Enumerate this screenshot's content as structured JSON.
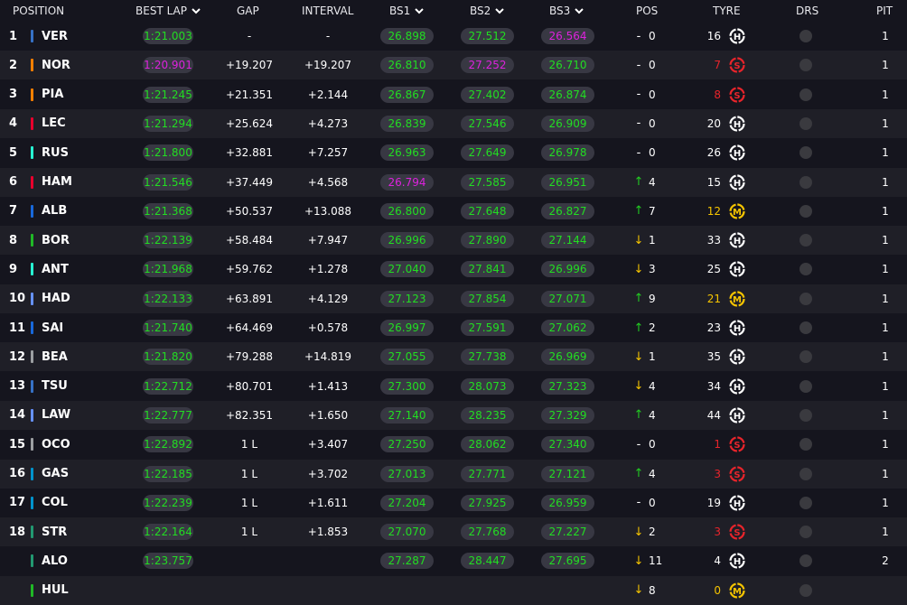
{
  "headers": {
    "position": "POSITION",
    "best_lap": "BEST LAP",
    "gap": "GAP",
    "interval": "INTERVAL",
    "bs1": "BS1",
    "bs2": "BS2",
    "bs3": "BS3",
    "pos": "POS",
    "tyre": "TYRE",
    "drs": "DRS",
    "pit": "PIT"
  },
  "colors": {
    "background": "#15151e",
    "row_alt": "#1f1f27",
    "pill_bg": "#383843",
    "best_green": "#22dd22",
    "best_purple": "#dd22dd",
    "pos_up": "#22cc22",
    "pos_down": "#f5c400",
    "tyre_soft": "#e8242b",
    "tyre_medium": "#f5c400",
    "tyre_hard": "#ffffff"
  },
  "rows": [
    {
      "position": "1",
      "code": "VER",
      "team_color": "#3671c6",
      "best_lap": "1:21.003",
      "best_lap_color": "green",
      "gap": "-",
      "interval": "-",
      "bs1": "26.898",
      "bs1_color": "green",
      "bs2": "27.512",
      "bs2_color": "green",
      "bs3": "26.564",
      "bs3_color": "purple",
      "pos_arrow": "-",
      "pos_direction": "none",
      "pos_change": "0",
      "laps": "16",
      "tyre": "H",
      "tyre_icon": "hard-tyre-icon",
      "tyre_color": "#ffffff",
      "pit": "1"
    },
    {
      "position": "2",
      "code": "NOR",
      "team_color": "#ff8000",
      "best_lap": "1:20.901",
      "best_lap_color": "purple",
      "gap": "+19.207",
      "interval": "+19.207",
      "bs1": "26.810",
      "bs1_color": "green",
      "bs2": "27.252",
      "bs2_color": "purple",
      "bs3": "26.710",
      "bs3_color": "green",
      "pos_arrow": "-",
      "pos_direction": "none",
      "pos_change": "0",
      "laps": "7",
      "tyre": "S",
      "tyre_icon": "soft-tyre-icon",
      "tyre_color": "#e8242b",
      "pit": "1"
    },
    {
      "position": "3",
      "code": "PIA",
      "team_color": "#ff8000",
      "best_lap": "1:21.245",
      "best_lap_color": "green",
      "gap": "+21.351",
      "interval": "+2.144",
      "bs1": "26.867",
      "bs1_color": "green",
      "bs2": "27.402",
      "bs2_color": "green",
      "bs3": "26.874",
      "bs3_color": "green",
      "pos_arrow": "-",
      "pos_direction": "none",
      "pos_change": "0",
      "laps": "8",
      "tyre": "S",
      "tyre_icon": "soft-tyre-icon",
      "tyre_color": "#e8242b",
      "pit": "1"
    },
    {
      "position": "4",
      "code": "LEC",
      "team_color": "#e8002d",
      "best_lap": "1:21.294",
      "best_lap_color": "green",
      "gap": "+25.624",
      "interval": "+4.273",
      "bs1": "26.839",
      "bs1_color": "green",
      "bs2": "27.546",
      "bs2_color": "green",
      "bs3": "26.909",
      "bs3_color": "green",
      "pos_arrow": "-",
      "pos_direction": "none",
      "pos_change": "0",
      "laps": "20",
      "tyre": "H",
      "tyre_icon": "hard-tyre-icon",
      "tyre_color": "#ffffff",
      "pit": "1"
    },
    {
      "position": "5",
      "code": "RUS",
      "team_color": "#27f4d2",
      "best_lap": "1:21.800",
      "best_lap_color": "green",
      "gap": "+32.881",
      "interval": "+7.257",
      "bs1": "26.963",
      "bs1_color": "green",
      "bs2": "27.649",
      "bs2_color": "green",
      "bs3": "26.978",
      "bs3_color": "green",
      "pos_arrow": "-",
      "pos_direction": "none",
      "pos_change": "0",
      "laps": "26",
      "tyre": "H",
      "tyre_icon": "hard-tyre-icon",
      "tyre_color": "#ffffff",
      "pit": "1"
    },
    {
      "position": "6",
      "code": "HAM",
      "team_color": "#e8002d",
      "best_lap": "1:21.546",
      "best_lap_color": "green",
      "gap": "+37.449",
      "interval": "+4.568",
      "bs1": "26.794",
      "bs1_color": "purple",
      "bs2": "27.585",
      "bs2_color": "green",
      "bs3": "26.951",
      "bs3_color": "green",
      "pos_arrow": "↑",
      "pos_direction": "up",
      "pos_change": "4",
      "laps": "15",
      "tyre": "H",
      "tyre_icon": "hard-tyre-icon",
      "tyre_color": "#ffffff",
      "pit": "1"
    },
    {
      "position": "7",
      "code": "ALB",
      "team_color": "#1868db",
      "best_lap": "1:21.368",
      "best_lap_color": "green",
      "gap": "+50.537",
      "interval": "+13.088",
      "bs1": "26.800",
      "bs1_color": "green",
      "bs2": "27.648",
      "bs2_color": "green",
      "bs3": "26.827",
      "bs3_color": "green",
      "pos_arrow": "↑",
      "pos_direction": "up",
      "pos_change": "7",
      "laps": "12",
      "tyre": "M",
      "tyre_icon": "medium-tyre-icon",
      "tyre_color": "#f5c400",
      "pit": "1"
    },
    {
      "position": "8",
      "code": "BOR",
      "team_color": "#20b826",
      "best_lap": "1:22.139",
      "best_lap_color": "green",
      "gap": "+58.484",
      "interval": "+7.947",
      "bs1": "26.996",
      "bs1_color": "green",
      "bs2": "27.890",
      "bs2_color": "green",
      "bs3": "27.144",
      "bs3_color": "green",
      "pos_arrow": "↓",
      "pos_direction": "down",
      "pos_change": "1",
      "laps": "33",
      "tyre": "H",
      "tyre_icon": "hard-tyre-icon",
      "tyre_color": "#ffffff",
      "pit": "1"
    },
    {
      "position": "9",
      "code": "ANT",
      "team_color": "#27f4d2",
      "best_lap": "1:21.968",
      "best_lap_color": "green",
      "gap": "+59.762",
      "interval": "+1.278",
      "bs1": "27.040",
      "bs1_color": "green",
      "bs2": "27.841",
      "bs2_color": "green",
      "bs3": "26.996",
      "bs3_color": "green",
      "pos_arrow": "↓",
      "pos_direction": "down",
      "pos_change": "3",
      "laps": "25",
      "tyre": "H",
      "tyre_icon": "hard-tyre-icon",
      "tyre_color": "#ffffff",
      "pit": "1"
    },
    {
      "position": "10",
      "code": "HAD",
      "team_color": "#6692ff",
      "best_lap": "1:22.133",
      "best_lap_color": "green",
      "gap": "+63.891",
      "interval": "+4.129",
      "bs1": "27.123",
      "bs1_color": "green",
      "bs2": "27.854",
      "bs2_color": "green",
      "bs3": "27.071",
      "bs3_color": "green",
      "pos_arrow": "↑",
      "pos_direction": "up",
      "pos_change": "9",
      "laps": "21",
      "tyre": "M",
      "tyre_icon": "medium-tyre-icon",
      "tyre_color": "#f5c400",
      "pit": "1"
    },
    {
      "position": "11",
      "code": "SAI",
      "team_color": "#1868db",
      "best_lap": "1:21.740",
      "best_lap_color": "green",
      "gap": "+64.469",
      "interval": "+0.578",
      "bs1": "26.997",
      "bs1_color": "green",
      "bs2": "27.591",
      "bs2_color": "green",
      "bs3": "27.062",
      "bs3_color": "green",
      "pos_arrow": "↑",
      "pos_direction": "up",
      "pos_change": "2",
      "laps": "23",
      "tyre": "H",
      "tyre_icon": "hard-tyre-icon",
      "tyre_color": "#ffffff",
      "pit": "1"
    },
    {
      "position": "12",
      "code": "BEA",
      "team_color": "#9c9fa2",
      "best_lap": "1:21.820",
      "best_lap_color": "green",
      "gap": "+79.288",
      "interval": "+14.819",
      "bs1": "27.055",
      "bs1_color": "green",
      "bs2": "27.738",
      "bs2_color": "green",
      "bs3": "26.969",
      "bs3_color": "green",
      "pos_arrow": "↓",
      "pos_direction": "down",
      "pos_change": "1",
      "laps": "35",
      "tyre": "H",
      "tyre_icon": "hard-tyre-icon",
      "tyre_color": "#ffffff",
      "pit": "1"
    },
    {
      "position": "13",
      "code": "TSU",
      "team_color": "#3671c6",
      "best_lap": "1:22.712",
      "best_lap_color": "green",
      "gap": "+80.701",
      "interval": "+1.413",
      "bs1": "27.300",
      "bs1_color": "green",
      "bs2": "28.073",
      "bs2_color": "green",
      "bs3": "27.323",
      "bs3_color": "green",
      "pos_arrow": "↓",
      "pos_direction": "down",
      "pos_change": "4",
      "laps": "34",
      "tyre": "H",
      "tyre_icon": "hard-tyre-icon",
      "tyre_color": "#ffffff",
      "pit": "1"
    },
    {
      "position": "14",
      "code": "LAW",
      "team_color": "#6692ff",
      "best_lap": "1:22.777",
      "best_lap_color": "green",
      "gap": "+82.351",
      "interval": "+1.650",
      "bs1": "27.140",
      "bs1_color": "green",
      "bs2": "28.235",
      "bs2_color": "green",
      "bs3": "27.329",
      "bs3_color": "green",
      "pos_arrow": "↑",
      "pos_direction": "up",
      "pos_change": "4",
      "laps": "44",
      "tyre": "H",
      "tyre_icon": "hard-tyre-icon",
      "tyre_color": "#ffffff",
      "pit": "1"
    },
    {
      "position": "15",
      "code": "OCO",
      "team_color": "#9c9fa2",
      "best_lap": "1:22.892",
      "best_lap_color": "green",
      "gap": "1 L",
      "interval": "+3.407",
      "bs1": "27.250",
      "bs1_color": "green",
      "bs2": "28.062",
      "bs2_color": "green",
      "bs3": "27.340",
      "bs3_color": "green",
      "pos_arrow": "-",
      "pos_direction": "none",
      "pos_change": "0",
      "laps": "1",
      "tyre": "S",
      "tyre_icon": "soft-tyre-icon",
      "tyre_color": "#e8242b",
      "pit": "1"
    },
    {
      "position": "16",
      "code": "GAS",
      "team_color": "#0093cc",
      "best_lap": "1:22.185",
      "best_lap_color": "green",
      "gap": "1 L",
      "interval": "+3.702",
      "bs1": "27.013",
      "bs1_color": "green",
      "bs2": "27.771",
      "bs2_color": "green",
      "bs3": "27.121",
      "bs3_color": "green",
      "pos_arrow": "↑",
      "pos_direction": "up",
      "pos_change": "4",
      "laps": "3",
      "tyre": "S",
      "tyre_icon": "soft-tyre-icon",
      "tyre_color": "#e8242b",
      "pit": "1"
    },
    {
      "position": "17",
      "code": "COL",
      "team_color": "#0093cc",
      "best_lap": "1:22.239",
      "best_lap_color": "green",
      "gap": "1 L",
      "interval": "+1.611",
      "bs1": "27.204",
      "bs1_color": "green",
      "bs2": "27.925",
      "bs2_color": "green",
      "bs3": "26.959",
      "bs3_color": "green",
      "pos_arrow": "-",
      "pos_direction": "none",
      "pos_change": "0",
      "laps": "19",
      "tyre": "H",
      "tyre_icon": "hard-tyre-icon",
      "tyre_color": "#ffffff",
      "pit": "1"
    },
    {
      "position": "18",
      "code": "STR",
      "team_color": "#229971",
      "best_lap": "1:22.164",
      "best_lap_color": "green",
      "gap": "1 L",
      "interval": "+1.853",
      "bs1": "27.070",
      "bs1_color": "green",
      "bs2": "27.768",
      "bs2_color": "green",
      "bs3": "27.227",
      "bs3_color": "green",
      "pos_arrow": "↓",
      "pos_direction": "down",
      "pos_change": "2",
      "laps": "3",
      "tyre": "S",
      "tyre_icon": "soft-tyre-icon",
      "tyre_color": "#e8242b",
      "pit": "1"
    },
    {
      "position": "",
      "code": "ALO",
      "team_color": "#229971",
      "best_lap": "1:23.757",
      "best_lap_color": "green",
      "gap": "",
      "interval": "",
      "bs1": "27.287",
      "bs1_color": "green",
      "bs2": "28.447",
      "bs2_color": "green",
      "bs3": "27.695",
      "bs3_color": "green",
      "pos_arrow": "↓",
      "pos_direction": "down",
      "pos_change": "11",
      "laps": "4",
      "tyre": "H",
      "tyre_icon": "hard-tyre-icon",
      "tyre_color": "#ffffff",
      "pit": "2"
    },
    {
      "position": "",
      "code": "HUL",
      "team_color": "#20b826",
      "best_lap": "",
      "best_lap_color": "green",
      "gap": "",
      "interval": "",
      "bs1": "",
      "bs1_color": "green",
      "bs2": "",
      "bs2_color": "green",
      "bs3": "",
      "bs3_color": "green",
      "pos_arrow": "↓",
      "pos_direction": "down",
      "pos_change": "8",
      "laps": "0",
      "tyre": "M",
      "tyre_icon": "medium-tyre-icon",
      "tyre_color": "#f5c400",
      "pit": ""
    }
  ]
}
